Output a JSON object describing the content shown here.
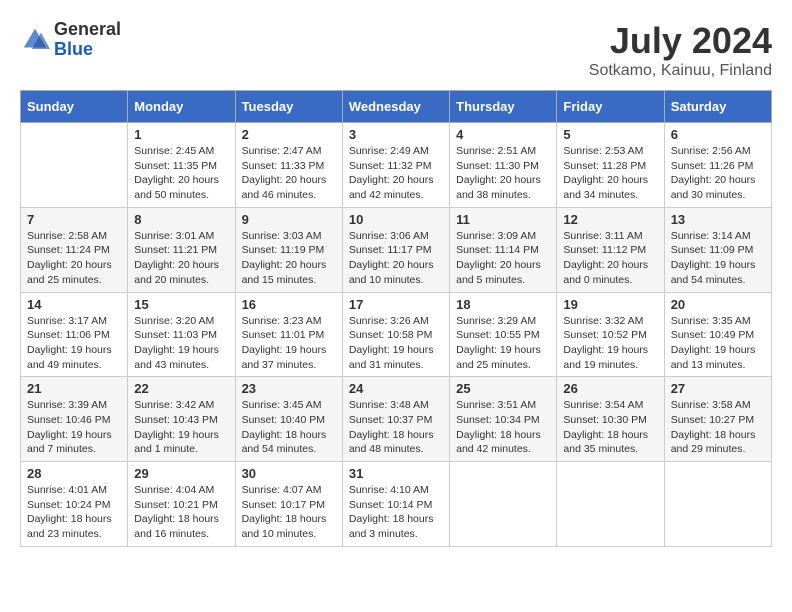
{
  "header": {
    "logo_general": "General",
    "logo_blue": "Blue",
    "title": "July 2024",
    "subtitle": "Sotkamo, Kainuu, Finland"
  },
  "days_of_week": [
    "Sunday",
    "Monday",
    "Tuesday",
    "Wednesday",
    "Thursday",
    "Friday",
    "Saturday"
  ],
  "weeks": [
    [
      {
        "day": "",
        "info": ""
      },
      {
        "day": "1",
        "info": "Sunrise: 2:45 AM\nSunset: 11:35 PM\nDaylight: 20 hours\nand 50 minutes."
      },
      {
        "day": "2",
        "info": "Sunrise: 2:47 AM\nSunset: 11:33 PM\nDaylight: 20 hours\nand 46 minutes."
      },
      {
        "day": "3",
        "info": "Sunrise: 2:49 AM\nSunset: 11:32 PM\nDaylight: 20 hours\nand 42 minutes."
      },
      {
        "day": "4",
        "info": "Sunrise: 2:51 AM\nSunset: 11:30 PM\nDaylight: 20 hours\nand 38 minutes."
      },
      {
        "day": "5",
        "info": "Sunrise: 2:53 AM\nSunset: 11:28 PM\nDaylight: 20 hours\nand 34 minutes."
      },
      {
        "day": "6",
        "info": "Sunrise: 2:56 AM\nSunset: 11:26 PM\nDaylight: 20 hours\nand 30 minutes."
      }
    ],
    [
      {
        "day": "7",
        "info": "Sunrise: 2:58 AM\nSunset: 11:24 PM\nDaylight: 20 hours\nand 25 minutes."
      },
      {
        "day": "8",
        "info": "Sunrise: 3:01 AM\nSunset: 11:21 PM\nDaylight: 20 hours\nand 20 minutes."
      },
      {
        "day": "9",
        "info": "Sunrise: 3:03 AM\nSunset: 11:19 PM\nDaylight: 20 hours\nand 15 minutes."
      },
      {
        "day": "10",
        "info": "Sunrise: 3:06 AM\nSunset: 11:17 PM\nDaylight: 20 hours\nand 10 minutes."
      },
      {
        "day": "11",
        "info": "Sunrise: 3:09 AM\nSunset: 11:14 PM\nDaylight: 20 hours\nand 5 minutes."
      },
      {
        "day": "12",
        "info": "Sunrise: 3:11 AM\nSunset: 11:12 PM\nDaylight: 20 hours\nand 0 minutes."
      },
      {
        "day": "13",
        "info": "Sunrise: 3:14 AM\nSunset: 11:09 PM\nDaylight: 19 hours\nand 54 minutes."
      }
    ],
    [
      {
        "day": "14",
        "info": "Sunrise: 3:17 AM\nSunset: 11:06 PM\nDaylight: 19 hours\nand 49 minutes."
      },
      {
        "day": "15",
        "info": "Sunrise: 3:20 AM\nSunset: 11:03 PM\nDaylight: 19 hours\nand 43 minutes."
      },
      {
        "day": "16",
        "info": "Sunrise: 3:23 AM\nSunset: 11:01 PM\nDaylight: 19 hours\nand 37 minutes."
      },
      {
        "day": "17",
        "info": "Sunrise: 3:26 AM\nSunset: 10:58 PM\nDaylight: 19 hours\nand 31 minutes."
      },
      {
        "day": "18",
        "info": "Sunrise: 3:29 AM\nSunset: 10:55 PM\nDaylight: 19 hours\nand 25 minutes."
      },
      {
        "day": "19",
        "info": "Sunrise: 3:32 AM\nSunset: 10:52 PM\nDaylight: 19 hours\nand 19 minutes."
      },
      {
        "day": "20",
        "info": "Sunrise: 3:35 AM\nSunset: 10:49 PM\nDaylight: 19 hours\nand 13 minutes."
      }
    ],
    [
      {
        "day": "21",
        "info": "Sunrise: 3:39 AM\nSunset: 10:46 PM\nDaylight: 19 hours\nand 7 minutes."
      },
      {
        "day": "22",
        "info": "Sunrise: 3:42 AM\nSunset: 10:43 PM\nDaylight: 19 hours\nand 1 minute."
      },
      {
        "day": "23",
        "info": "Sunrise: 3:45 AM\nSunset: 10:40 PM\nDaylight: 18 hours\nand 54 minutes."
      },
      {
        "day": "24",
        "info": "Sunrise: 3:48 AM\nSunset: 10:37 PM\nDaylight: 18 hours\nand 48 minutes."
      },
      {
        "day": "25",
        "info": "Sunrise: 3:51 AM\nSunset: 10:34 PM\nDaylight: 18 hours\nand 42 minutes."
      },
      {
        "day": "26",
        "info": "Sunrise: 3:54 AM\nSunset: 10:30 PM\nDaylight: 18 hours\nand 35 minutes."
      },
      {
        "day": "27",
        "info": "Sunrise: 3:58 AM\nSunset: 10:27 PM\nDaylight: 18 hours\nand 29 minutes."
      }
    ],
    [
      {
        "day": "28",
        "info": "Sunrise: 4:01 AM\nSunset: 10:24 PM\nDaylight: 18 hours\nand 23 minutes."
      },
      {
        "day": "29",
        "info": "Sunrise: 4:04 AM\nSunset: 10:21 PM\nDaylight: 18 hours\nand 16 minutes."
      },
      {
        "day": "30",
        "info": "Sunrise: 4:07 AM\nSunset: 10:17 PM\nDaylight: 18 hours\nand 10 minutes."
      },
      {
        "day": "31",
        "info": "Sunrise: 4:10 AM\nSunset: 10:14 PM\nDaylight: 18 hours\nand 3 minutes."
      },
      {
        "day": "",
        "info": ""
      },
      {
        "day": "",
        "info": ""
      },
      {
        "day": "",
        "info": ""
      }
    ]
  ]
}
